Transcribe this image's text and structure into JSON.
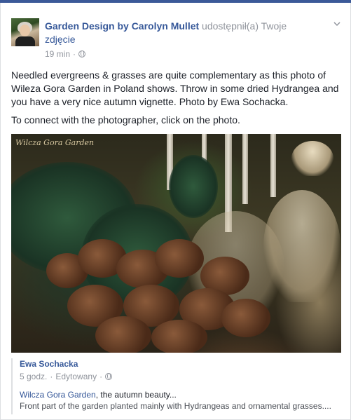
{
  "post": {
    "author": "Garden Design by Carolyn Mullet",
    "action": "udostępnił(a) Twoje",
    "shared_object": "zdjęcie",
    "time": "19 min",
    "dot": "·",
    "privacy_icon": "globe-icon",
    "paragraph1": "Needled evergreens & grasses are quite complementary as this photo of Wileza Gora Garden in Poland shows. Throw in some dried Hydrangea and you have a very nice autumn vignette. Photo by Ewa Sochacka.",
    "paragraph2": "To connect with the photographer, click on the photo."
  },
  "photo": {
    "watermark": "Wilcza Gora Garden"
  },
  "attachment": {
    "name": "Ewa Sochacka",
    "time": "5 godz.",
    "dot": "·",
    "edited": "Edytowany",
    "dot2": "·",
    "link_text": "Wilcza Gora Garden",
    "link_suffix": ", the autumn beauty...",
    "description": "Front part of the garden planted mainly with Hydrangeas and ornamental grasses...."
  },
  "colors": {
    "link": "#365899",
    "meta": "#90949c",
    "text": "#1d2129",
    "brand": "#3b5998"
  }
}
